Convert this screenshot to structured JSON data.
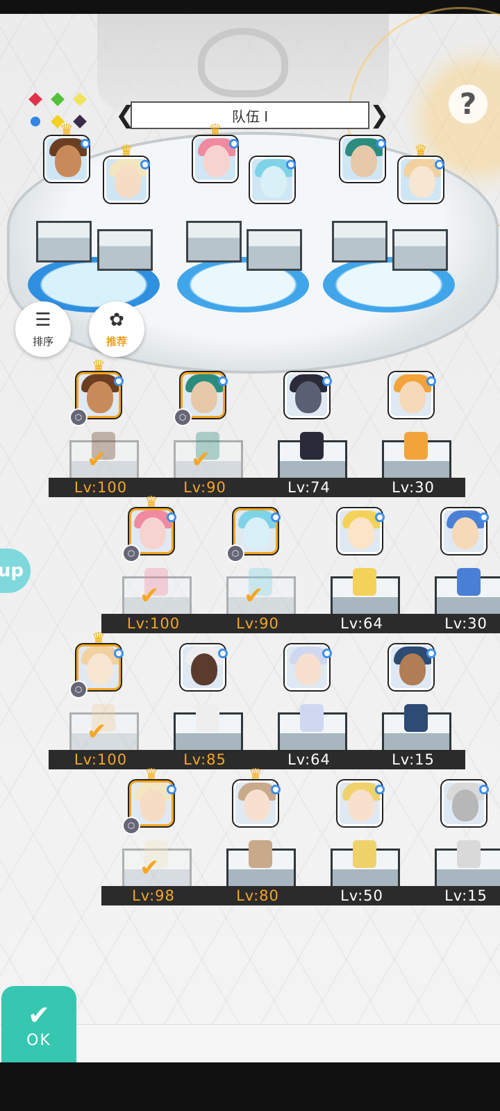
{
  "header": {
    "team_label": "队伍 I",
    "prev_arrow": "❮",
    "next_arrow": "❯",
    "help_label": "?"
  },
  "tools": {
    "sort_label": "排序",
    "recommend_label": "推荐"
  },
  "side_tab": {
    "label": "up"
  },
  "ok_button": {
    "label": "OK"
  },
  "colors": {
    "selected_frame": "#f6a623",
    "ok_button": "#36c7b1",
    "crown": "#f6b21e",
    "level_gold": "#f6a623"
  },
  "roster": [
    {
      "level": "Lv:100",
      "selected": true,
      "crown": true
    },
    {
      "level": "Lv:90",
      "selected": true,
      "crown": false
    },
    {
      "level": "Lv:74",
      "selected": false,
      "crown": false
    },
    {
      "level": "Lv:30",
      "selected": false,
      "crown": false
    },
    {
      "level": "Lv:100",
      "selected": true,
      "crown": true
    },
    {
      "level": "Lv:90",
      "selected": true,
      "crown": false
    },
    {
      "level": "Lv:64",
      "selected": false,
      "crown": false
    },
    {
      "level": "Lv:30",
      "selected": false,
      "crown": false
    },
    {
      "level": "Lv:100",
      "selected": true,
      "crown": true
    },
    {
      "level": "Lv:85",
      "selected": false,
      "crown": false
    },
    {
      "level": "Lv:64",
      "selected": false,
      "crown": false
    },
    {
      "level": "Lv:15",
      "selected": false,
      "crown": false
    },
    {
      "level": "Lv:98",
      "selected": true,
      "crown": true
    },
    {
      "level": "Lv:80",
      "selected": false,
      "crown": true
    },
    {
      "level": "Lv:50",
      "selected": false,
      "crown": false
    },
    {
      "level": "Lv:15",
      "selected": false,
      "crown": false
    }
  ]
}
